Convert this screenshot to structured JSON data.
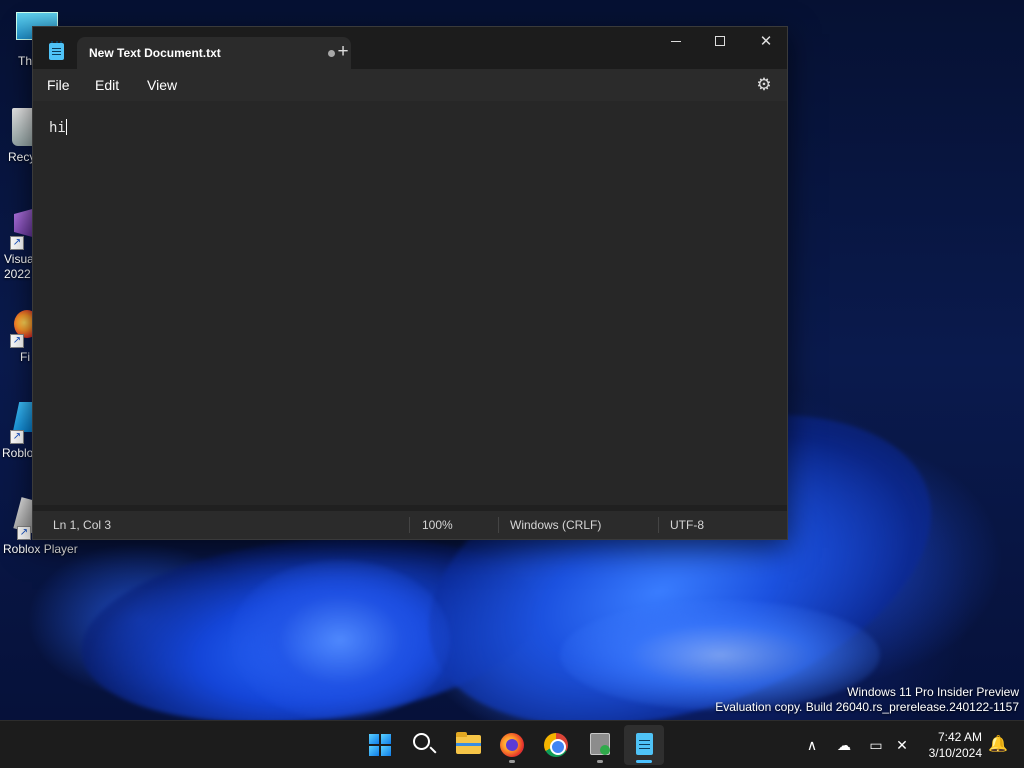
{
  "desktop": {
    "icons": [
      {
        "label": "Th",
        "icon": "this-pc-icon"
      },
      {
        "label": "Recy",
        "icon": "recycle-bin-icon"
      },
      {
        "label": "Visua\n2022",
        "line1": "Visua",
        "line2": "2022",
        "icon": "visual-studio-icon"
      },
      {
        "label": "Fi",
        "icon": "firefox-icon"
      },
      {
        "label": "Roblo",
        "icon": "roblox-studio-icon"
      },
      {
        "label": "Roblox Player",
        "icon": "roblox-player-icon"
      }
    ],
    "watermark": {
      "line1": "Windows 11 Pro Insider Preview",
      "line2": "Evaluation copy. Build 26040.rs_prerelease.240122-1157"
    }
  },
  "notepad": {
    "tab_title": "New Text Document.txt",
    "new_tab_symbol": "+",
    "menu": {
      "file": "File",
      "edit": "Edit",
      "view": "View"
    },
    "content": "hi",
    "status": {
      "position": "Ln 1, Col 3",
      "zoom": "100%",
      "line_ending": "Windows (CRLF)",
      "encoding": "UTF-8"
    },
    "controls": {
      "minimize": "",
      "maximize": "",
      "close": "✕"
    },
    "settings_icon": "⚙"
  },
  "taskbar": {
    "apps": [
      "start-icon",
      "search-icon",
      "file-explorer-icon",
      "firefox-icon",
      "chrome-icon",
      "tool-icon",
      "notepad-icon"
    ],
    "tray": {
      "chevron": "∧",
      "cloud": "☁",
      "network": "▭",
      "volume": "✕"
    },
    "clock": {
      "time": "7:42 AM",
      "date": "3/10/2024"
    },
    "bell": "🔔"
  },
  "colors": {
    "accent": "#4cc2ff",
    "window_bg": "#202020",
    "editor_bg": "#272727"
  }
}
